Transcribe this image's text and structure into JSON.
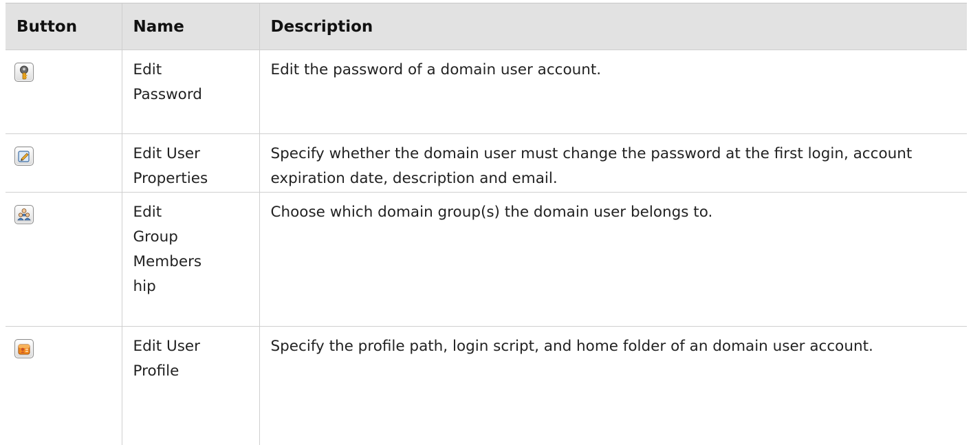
{
  "headers": {
    "button": "Button",
    "name": "Name",
    "description": "Description"
  },
  "rows": [
    {
      "icon": "key-icon",
      "name_lines": [
        "Edit",
        "Password"
      ],
      "description": "Edit the password of a domain user account."
    },
    {
      "icon": "edit-pencil-icon",
      "name_lines": [
        "Edit User",
        "Properties"
      ],
      "description": "Specify whether the domain user must change the password at the first login, account expiration date, description and email."
    },
    {
      "icon": "group-users-icon",
      "name_lines": [
        "Edit",
        "Group",
        "Members",
        "hip"
      ],
      "description": "Choose which domain group(s) the domain user belongs to."
    },
    {
      "icon": "profile-folder-icon",
      "name_lines": [
        "Edit User",
        "Profile"
      ],
      "description": "Specify the profile path, login script, and home folder of an domain user account."
    }
  ]
}
